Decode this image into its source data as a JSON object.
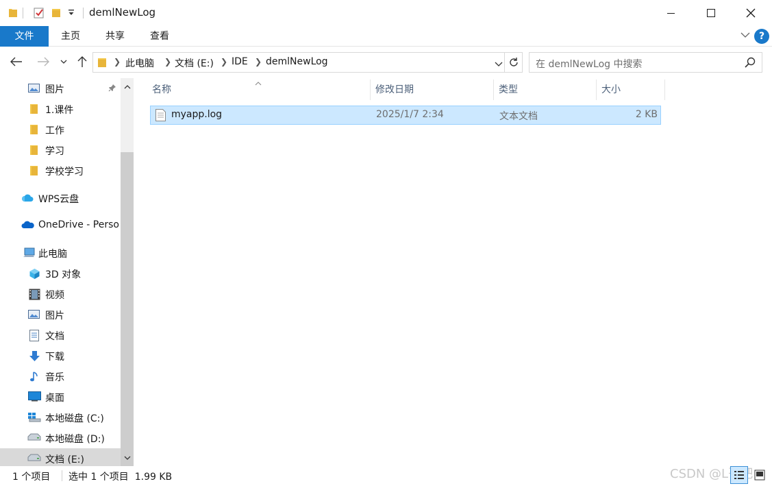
{
  "window": {
    "title": "demlNewLog",
    "controls": [
      "minimize",
      "maximize",
      "close"
    ]
  },
  "quick_access_toolbar": {
    "icons": [
      "folder-icon",
      "properties-check-icon",
      "new-folder-icon",
      "customize-dropdown-icon"
    ]
  },
  "ribbon": {
    "tabs": [
      "文件",
      "主页",
      "共享",
      "查看"
    ],
    "active_tab": "文件",
    "help_label": "?"
  },
  "address": {
    "crumbs": [
      "此电脑",
      "文档 (E:)",
      "IDE",
      "demlNewLog"
    ]
  },
  "search": {
    "placeholder": "在 demlNewLog 中搜索"
  },
  "sidebar": {
    "items": [
      {
        "label": "图片",
        "icon": "pictures-icon",
        "pinned": true
      },
      {
        "label": "1.课件",
        "icon": "folder-icon"
      },
      {
        "label": "工作",
        "icon": "folder-icon"
      },
      {
        "label": "学习",
        "icon": "folder-icon"
      },
      {
        "label": "学校学习",
        "icon": "folder-icon"
      },
      {
        "label": "WPS云盘",
        "icon": "wps-cloud-icon"
      },
      {
        "label": "OneDrive - Perso",
        "icon": "onedrive-cloud-icon"
      },
      {
        "label": "此电脑",
        "icon": "this-pc-icon"
      },
      {
        "label": "3D 对象",
        "icon": "3d-objects-icon"
      },
      {
        "label": "视频",
        "icon": "videos-icon"
      },
      {
        "label": "图片",
        "icon": "pictures-icon"
      },
      {
        "label": "文档",
        "icon": "documents-icon"
      },
      {
        "label": "下载",
        "icon": "downloads-icon"
      },
      {
        "label": "音乐",
        "icon": "music-icon"
      },
      {
        "label": "桌面",
        "icon": "desktop-icon"
      },
      {
        "label": "本地磁盘 (C:)",
        "icon": "windows-drive-icon"
      },
      {
        "label": "本地磁盘 (D:)",
        "icon": "drive-icon"
      },
      {
        "label": "文档 (E:)",
        "icon": "drive-icon",
        "selected": true
      }
    ]
  },
  "file_list": {
    "columns": [
      "名称",
      "修改日期",
      "类型",
      "大小"
    ],
    "rows": [
      {
        "name": "myapp.log",
        "modified": "2025/1/7 2:34",
        "type": "文本文档",
        "size": "2 KB",
        "selected": true
      }
    ]
  },
  "status": {
    "item_count": "1 个项目",
    "selection": "选中 1 个项目  1.99 KB"
  },
  "watermark": "CSDN @L哥吧",
  "colors": {
    "accent": "#1979ca",
    "selection_bg": "#cce8ff",
    "selection_border": "#99d1ff",
    "header_text": "#4c607a",
    "folder_yellow": "#f3c84b"
  }
}
